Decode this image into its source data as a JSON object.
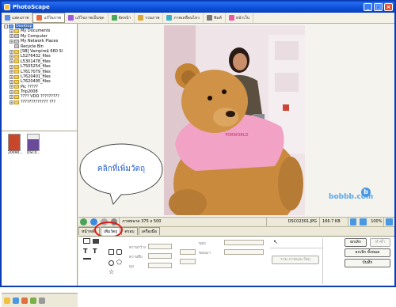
{
  "window": {
    "title": "PhotoScape",
    "controls": [
      "_",
      "□",
      "×"
    ]
  },
  "toolbar": {
    "tabs": [
      {
        "label": "แสดงภาพ",
        "icon": "viewer-icon",
        "color": "#5b8be8"
      },
      {
        "label": "แก้ไขภาพ",
        "icon": "editor-icon",
        "color": "#e86a3a"
      },
      {
        "label": "แก้ไขภาพเป็นชุด",
        "icon": "batch-icon",
        "color": "#9c5bd8"
      },
      {
        "label": "จัดหน้า",
        "icon": "page-icon",
        "color": "#48a85a"
      },
      {
        "label": "รวมภาพ",
        "icon": "combine-icon",
        "color": "#d8a83a"
      },
      {
        "label": "ภาพเคลื่อนไหว",
        "icon": "animation-icon",
        "color": "#3ab0c8"
      },
      {
        "label": "พิมพ์",
        "icon": "print-icon",
        "color": "#777777"
      },
      {
        "label": "หน้าเว็บ",
        "icon": "web-icon",
        "color": "#e85aa0"
      }
    ],
    "active": "แก้ไขภาพ"
  },
  "tree": [
    {
      "label": "Desktop",
      "indent": 0,
      "exp": "-",
      "type": "blue",
      "selected": true
    },
    {
      "label": "My Documents",
      "indent": 1,
      "exp": "+",
      "type": "yellow"
    },
    {
      "label": "My Computer",
      "indent": 1,
      "exp": "+",
      "type": "gray"
    },
    {
      "label": "My Network Places",
      "indent": 1,
      "exp": "+",
      "type": "gray"
    },
    {
      "label": "Recycle Bin",
      "indent": 1,
      "exp": "",
      "type": "gray"
    },
    {
      "label": "[SB] Vampire$ 660 Sl",
      "indent": 1,
      "exp": "+",
      "type": "yellow"
    },
    {
      "label": "L5276432_files",
      "indent": 1,
      "exp": "+",
      "type": "yellow"
    },
    {
      "label": "L5301478_files",
      "indent": 1,
      "exp": "+",
      "type": "yellow"
    },
    {
      "label": "L7505254_files",
      "indent": 1,
      "exp": "+",
      "type": "yellow"
    },
    {
      "label": "L7617079_files",
      "indent": 1,
      "exp": "+",
      "type": "yellow"
    },
    {
      "label": "L7620401_files",
      "indent": 1,
      "exp": "+",
      "type": "yellow"
    },
    {
      "label": "L7620495_files",
      "indent": 1,
      "exp": "+",
      "type": "yellow"
    },
    {
      "label": "Pic ?????",
      "indent": 1,
      "exp": "+",
      "type": "yellow"
    },
    {
      "label": "Trip2008",
      "indent": 1,
      "exp": "+",
      "type": "yellow"
    },
    {
      "label": "???? VDO ?????????",
      "indent": 1,
      "exp": "+",
      "type": "yellow"
    },
    {
      "label": "????????????? ???",
      "indent": 1,
      "exp": "+",
      "type": "yellow"
    }
  ],
  "thumbnails": [
    {
      "caption": "20090...",
      "color": "#c8462a"
    },
    {
      "caption": "DSC0...",
      "color": "#6a4a9a"
    }
  ],
  "callout": {
    "text": "คลิกที่เพิ่มวัตถุ"
  },
  "navbar": {
    "image_size": "ภาพขนาด 375 x 500",
    "file_name": "DSC02301.JPG",
    "file_size": "166.7 KB",
    "zoom": "100%"
  },
  "edit_tabs": [
    "หน้าหลัก",
    "เพิ่มวัตถุ",
    "ครอบ",
    "เครื่องมือ"
  ],
  "edit_tabs_active": 1,
  "edit_panel": {
    "ok_button": "ยกเลิก",
    "undo_all_button": "ทำซ้ำ",
    "cancel_all_button": "ยกเลิก ทั้งหมด",
    "save_button": "บันทึก",
    "color_pick_button": "รวม ภาพและวัตถุ",
    "label_width": "ความกว้าง",
    "label_opacity": "ความทึบ",
    "label_angle": "มุม",
    "label_border": "ขอบ",
    "label_shadow": "ขอบเงา"
  },
  "watermark": "bobbb.com"
}
